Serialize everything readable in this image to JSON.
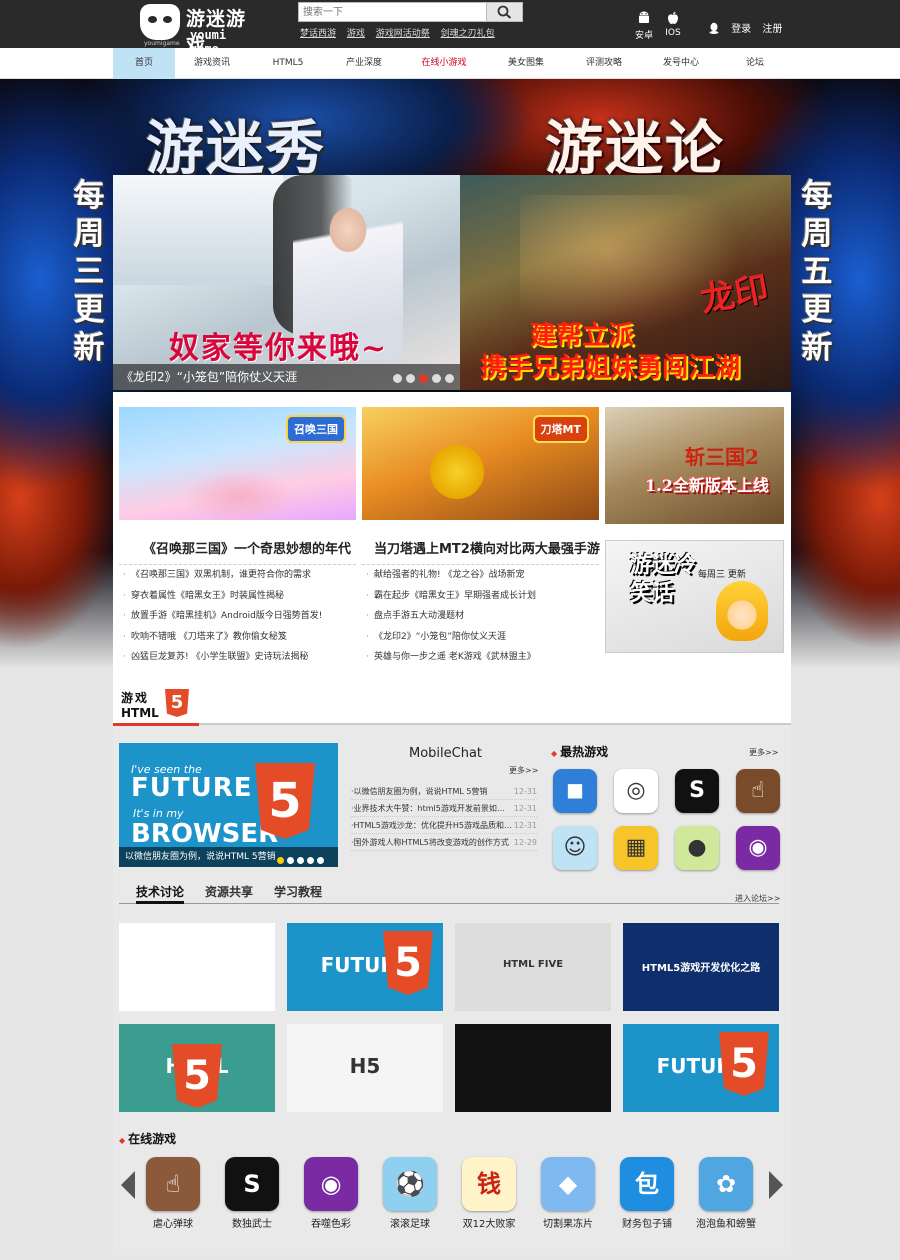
{
  "header": {
    "logo_cn": "游迷游戏",
    "logo_en": "youmi game",
    "logo_small": "youmigame",
    "search_placeholder": "搜索一下",
    "quick_links": [
      "梦话西游",
      "游戏",
      "游戏网活动祭",
      "剑魂之刃礼包"
    ],
    "platforms": [
      {
        "label": "安卓",
        "icon": "android-icon"
      },
      {
        "label": "IOS",
        "icon": "apple-icon"
      }
    ],
    "login": "登录",
    "register": "注册"
  },
  "nav": {
    "items": [
      "首页",
      "游戏资讯",
      "HTML5",
      "产业深度",
      "在线小游戏",
      "美女图集",
      "评测攻略",
      "发号中心",
      "论坛"
    ],
    "active_index": 0,
    "hot_index": 4,
    "colors": {
      "active_bg": "#bfe3f5",
      "hot": "#d0021b"
    }
  },
  "banner": {
    "title_left": "游迷秀",
    "title_right": "游迷论",
    "side_left": "每周三更新",
    "side_right": "每周五更新",
    "slide_left_text": "奴家等你来哦~",
    "slide_right_line1": "建帮立派",
    "slide_right_line2": "携手兄弟姐妹勇闯江湖",
    "slide_right_brand": "龙印",
    "caption": "《龙印2》“小笼包”陪你仗义天涯",
    "dots_total": 5,
    "dots_active": 2
  },
  "featured": [
    {
      "badge": "召唤三国",
      "title": "《召唤那三国》一个奇思妙想的年代",
      "news": [
        "《召唤那三国》双黑机制，谁更符合你的需求",
        "穿衣着属性《暗黑女王》时装属性揭秘",
        "放置手游《暗黑挂机》Android版今日强势首发!",
        "吹响不错哦 《刀塔来了》教你偷女秘笈",
        "凶猛巨龙复苏! 《小学生联盟》史诗玩法揭秘"
      ]
    },
    {
      "badge": "刀塔MT",
      "title": "当刀塔遇上MT2横向对比两大最强手游",
      "news": [
        "献给强者的礼物! 《龙之谷》战场新宠",
        "霸在起步《暗黑女王》早期强者成长计划",
        "盘点手游五大动漫题材",
        "《龙印2》“小笼包”陪你仗义天涯",
        "英雄与你一步之遥 老K游戏《武林盟主》"
      ]
    }
  ],
  "side_images": [
    {
      "title": "斩三国2",
      "subtitle": "1.2全新版本上线"
    },
    {
      "title": "游迷冷笑话",
      "face_text": "每周三 更新"
    }
  ],
  "html5": {
    "section_label": "游戏",
    "section_html": "HTML",
    "section_five": "5",
    "feature": {
      "line1": "I've seen the",
      "line2": "FUTURE",
      "line3": "It's in my",
      "line4": "BROWSER",
      "caption": "以微信朋友圈为例，说说HTML 5营销",
      "dots_total": 5,
      "dots_active": 0
    },
    "mobilechat": {
      "title": "MobileChat",
      "more": "更多>>",
      "items": [
        {
          "text": "·以微信朋友圈为例，说说HTML 5营销",
          "date": "12-31"
        },
        {
          "text": "·业界技术大牛赞：html5游戏开发前景如…",
          "date": "12-31"
        },
        {
          "text": "·HTML5游戏沙龙：优化提升H5游戏品质和…",
          "date": "12-31"
        },
        {
          "text": "·国外游戏人称HTML5将改变游戏的创作方式",
          "date": "12-29"
        }
      ]
    },
    "hot_games": {
      "title": "最热游戏",
      "more": "更多>>",
      "icons": [
        {
          "name": "black-monster-icon",
          "bg": "#2f7fd8",
          "glyph": "◼"
        },
        {
          "name": "brain-bulb-icon",
          "bg": "#ffffff",
          "glyph": "◎"
        },
        {
          "name": "sudoku-samurai-icon",
          "bg": "#111111",
          "glyph": "S"
        },
        {
          "name": "tap-finger-icon",
          "bg": "#7a4b2a",
          "glyph": "☝"
        },
        {
          "name": "cat-jump-icon",
          "bg": "#bde3f5",
          "glyph": "☺"
        },
        {
          "name": "fruit-grid-icon",
          "bg": "#f7c52a",
          "glyph": "▦"
        },
        {
          "name": "ball-tube-icon",
          "bg": "#cfe89a",
          "glyph": "●"
        },
        {
          "name": "purple-monster-icon",
          "bg": "#7a2aa3",
          "glyph": "◉"
        }
      ]
    },
    "tabs": [
      "技术讨论",
      "资源共享",
      "学习教程"
    ],
    "tabs_active": 0,
    "forum_link": "进入论坛>>",
    "thumbs": [
      {
        "name": "phone-apps-thumb",
        "bg": "#ffffff",
        "label": ""
      },
      {
        "name": "future-browser-thumb",
        "bg": "#1c93c9",
        "label": "FUTURE"
      },
      {
        "name": "fists-thumb",
        "bg": "#dcdcdc",
        "label": "HTML FIVE"
      },
      {
        "name": "html5-optimize-thumb",
        "bg": "#0e2f6b",
        "label": "HTML5游戏开发优化之路"
      },
      {
        "name": "html5-logo-thumb",
        "bg": "#3a9d8f",
        "label": "HTML"
      },
      {
        "name": "h5-letters-thumb",
        "bg": "#f5f5f5",
        "label": "H5"
      },
      {
        "name": "rocket-thumb",
        "bg": "#111111",
        "label": ""
      },
      {
        "name": "future-browser-thumb-2",
        "bg": "#1c93c9",
        "label": "FUTURE"
      }
    ]
  },
  "online": {
    "title": "在线游戏",
    "games": [
      {
        "label": "虐心弹球",
        "icon": "finger-tap-icon",
        "bg": "#8a5a3a",
        "glyph": "☝"
      },
      {
        "label": "数独武士",
        "icon": "samurai-icon",
        "bg": "#111111",
        "glyph": "S"
      },
      {
        "label": "吞噬色彩",
        "icon": "purple-monster-icon",
        "bg": "#7a2aa3",
        "glyph": "◉"
      },
      {
        "label": "滚滚足球",
        "icon": "soccer-icon",
        "bg": "#8fd0f0",
        "glyph": "⚽"
      },
      {
        "label": "双12大败家",
        "icon": "money-text-icon",
        "bg": "#fff3c9",
        "glyph": "钱"
      },
      {
        "label": "切割果冻片",
        "icon": "jelly-icon",
        "bg": "#7fb9f0",
        "glyph": "◆"
      },
      {
        "label": "财务包子铺",
        "icon": "bun-icon",
        "bg": "#1f8de0",
        "glyph": "包"
      },
      {
        "label": "泡泡鱼和螃蟹",
        "icon": "crab-icon",
        "bg": "#4fa6e0",
        "glyph": "✿"
      }
    ]
  }
}
